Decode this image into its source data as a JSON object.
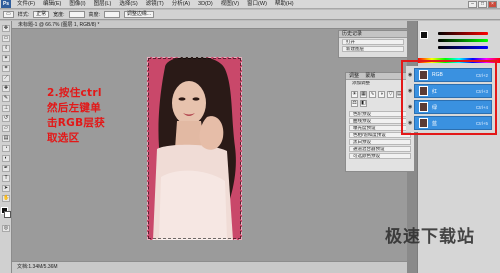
{
  "menubar": {
    "logo": "Ps",
    "items": [
      "文件(F)",
      "编辑(E)",
      "图像(I)",
      "图层(L)",
      "选择(S)",
      "滤镜(T)",
      "分析(A)",
      "3D(D)",
      "视图(V)",
      "窗口(W)",
      "帮助(H)"
    ]
  },
  "optbar": {
    "style_label": "样式:",
    "style_value": "正常",
    "width_label": "宽度:",
    "height_label": "高度:",
    "refine_button": "调整边缘..."
  },
  "document": {
    "title": "未标题-1 @ 66.7% (图层 1, RGB/8) *"
  },
  "instruction": {
    "lines": [
      "2.按住ctrl",
      "然后左键单",
      "击RGB层获",
      "取选区"
    ]
  },
  "status": {
    "text": "文档:1.34M/5.36M"
  },
  "history_panel": {
    "tab": "历史记录",
    "items": [
      "打开",
      "新建图层"
    ]
  },
  "adjust_panel": {
    "tabs": [
      "调整",
      "蒙版"
    ],
    "header": "添加调整",
    "items": [
      "色阶预设",
      "曲线预设",
      "曝光度预设",
      "色相/饱和度预设",
      "黑白预设",
      "通道混合器预设",
      "可选颜色预设"
    ]
  },
  "layers": {
    "rows": [
      {
        "name": "RGB",
        "shortcut": "Ctrl+2"
      },
      {
        "name": "红",
        "shortcut": "Ctrl+3"
      },
      {
        "name": "绿",
        "shortcut": "Ctrl+4"
      },
      {
        "name": "蓝",
        "shortcut": "Ctrl+5"
      }
    ]
  },
  "colors": {
    "accent_red": "#e31818",
    "layer_highlight": "#3a91e0",
    "photo_bg": "#c9486a"
  },
  "watermark": "极速下载站"
}
